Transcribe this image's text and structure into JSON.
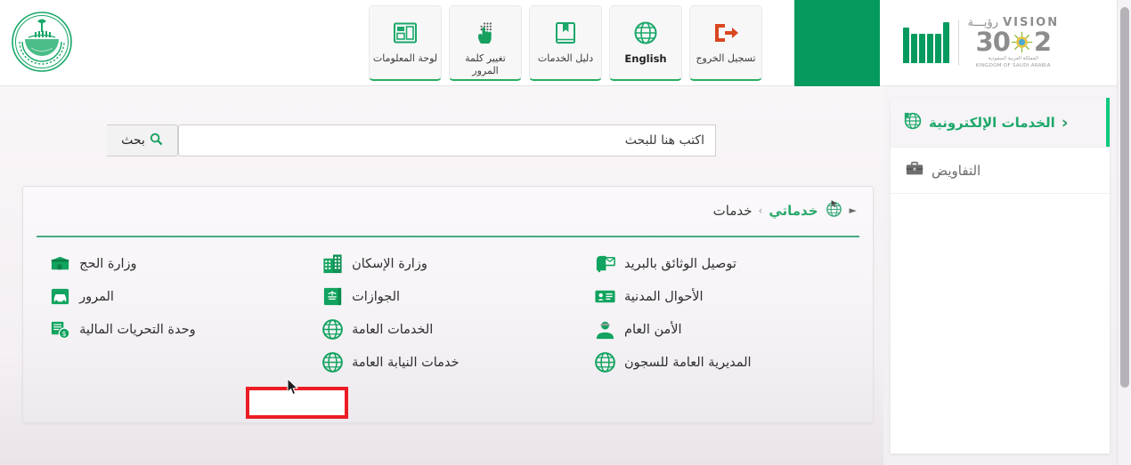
{
  "header": {
    "emblem_alt": "saudi-ministry-of-interior-emblem",
    "nav_buttons": [
      {
        "label": "تسجيل الخروج",
        "icon": "logout-icon",
        "english": false
      },
      {
        "label": "English",
        "icon": "globe-icon",
        "english": true
      },
      {
        "label": "دليل الخدمات",
        "icon": "book-icon",
        "english": false
      },
      {
        "label": "تغيير كلمة المرور",
        "icon": "fingerprint-touch-icon",
        "english": false
      },
      {
        "label": "لوحة المعلومات",
        "icon": "dashboard-icon",
        "english": false
      }
    ],
    "vision": {
      "word": "VISION",
      "arabic": "رؤيـــة",
      "number_left": "2",
      "number_right": "30",
      "sub_arabic": "المملكة العربية السعودية",
      "sub_english": "KINGDOM OF SAUDI ARABIA"
    },
    "absher_logo": "absher-logo"
  },
  "search": {
    "placeholder": "اكتب هنا للبحث",
    "value": "",
    "button_label": "بحث",
    "button_icon": "search-icon"
  },
  "breadcrumb": {
    "icon": "globe-cursor-icon",
    "arrow": "►",
    "current": "خدماتي",
    "separator": "›",
    "parent": "خدمات"
  },
  "services": {
    "columns": [
      {
        "items": [
          {
            "label": "توصيل الوثائق بالبريد",
            "icon": "mailbox-icon"
          },
          {
            "label": "الأحوال المدنية",
            "icon": "id-card-icon"
          },
          {
            "label": "الأمن العام",
            "icon": "police-officer-icon"
          },
          {
            "label": "المديرية العامة للسجون",
            "icon": "globe-icon"
          }
        ]
      },
      {
        "items": [
          {
            "label": "وزارة الإسكان",
            "icon": "building-icon"
          },
          {
            "label": "الجوازات",
            "icon": "passport-icon"
          },
          {
            "label": "الخدمات العامة",
            "icon": "globe-icon"
          },
          {
            "label": "خدمات النيابة العامة",
            "icon": "globe-icon"
          }
        ]
      },
      {
        "items": [
          {
            "label": "وزارة الحج",
            "icon": "kaaba-icon"
          },
          {
            "label": "المرور",
            "icon": "traffic-icon",
            "highlighted": true
          },
          {
            "label": "وحدة التحريات المالية",
            "icon": "financial-documents-icon"
          }
        ]
      }
    ]
  },
  "sidebar": {
    "header": {
      "label": "الخدمات الإلكترونية",
      "icon": "globe-badge-icon",
      "chevron": "‹"
    },
    "items": [
      {
        "label": "التفاويض",
        "icon": "briefcase-icon"
      }
    ]
  },
  "colors": {
    "brand_green": "#069a5e",
    "accent_green": "#0ec97e",
    "link_green": "#1ea86b",
    "highlight_red": "#ec1c24",
    "logout_red": "#d9461f",
    "page_bg": "#f7f3f6"
  }
}
